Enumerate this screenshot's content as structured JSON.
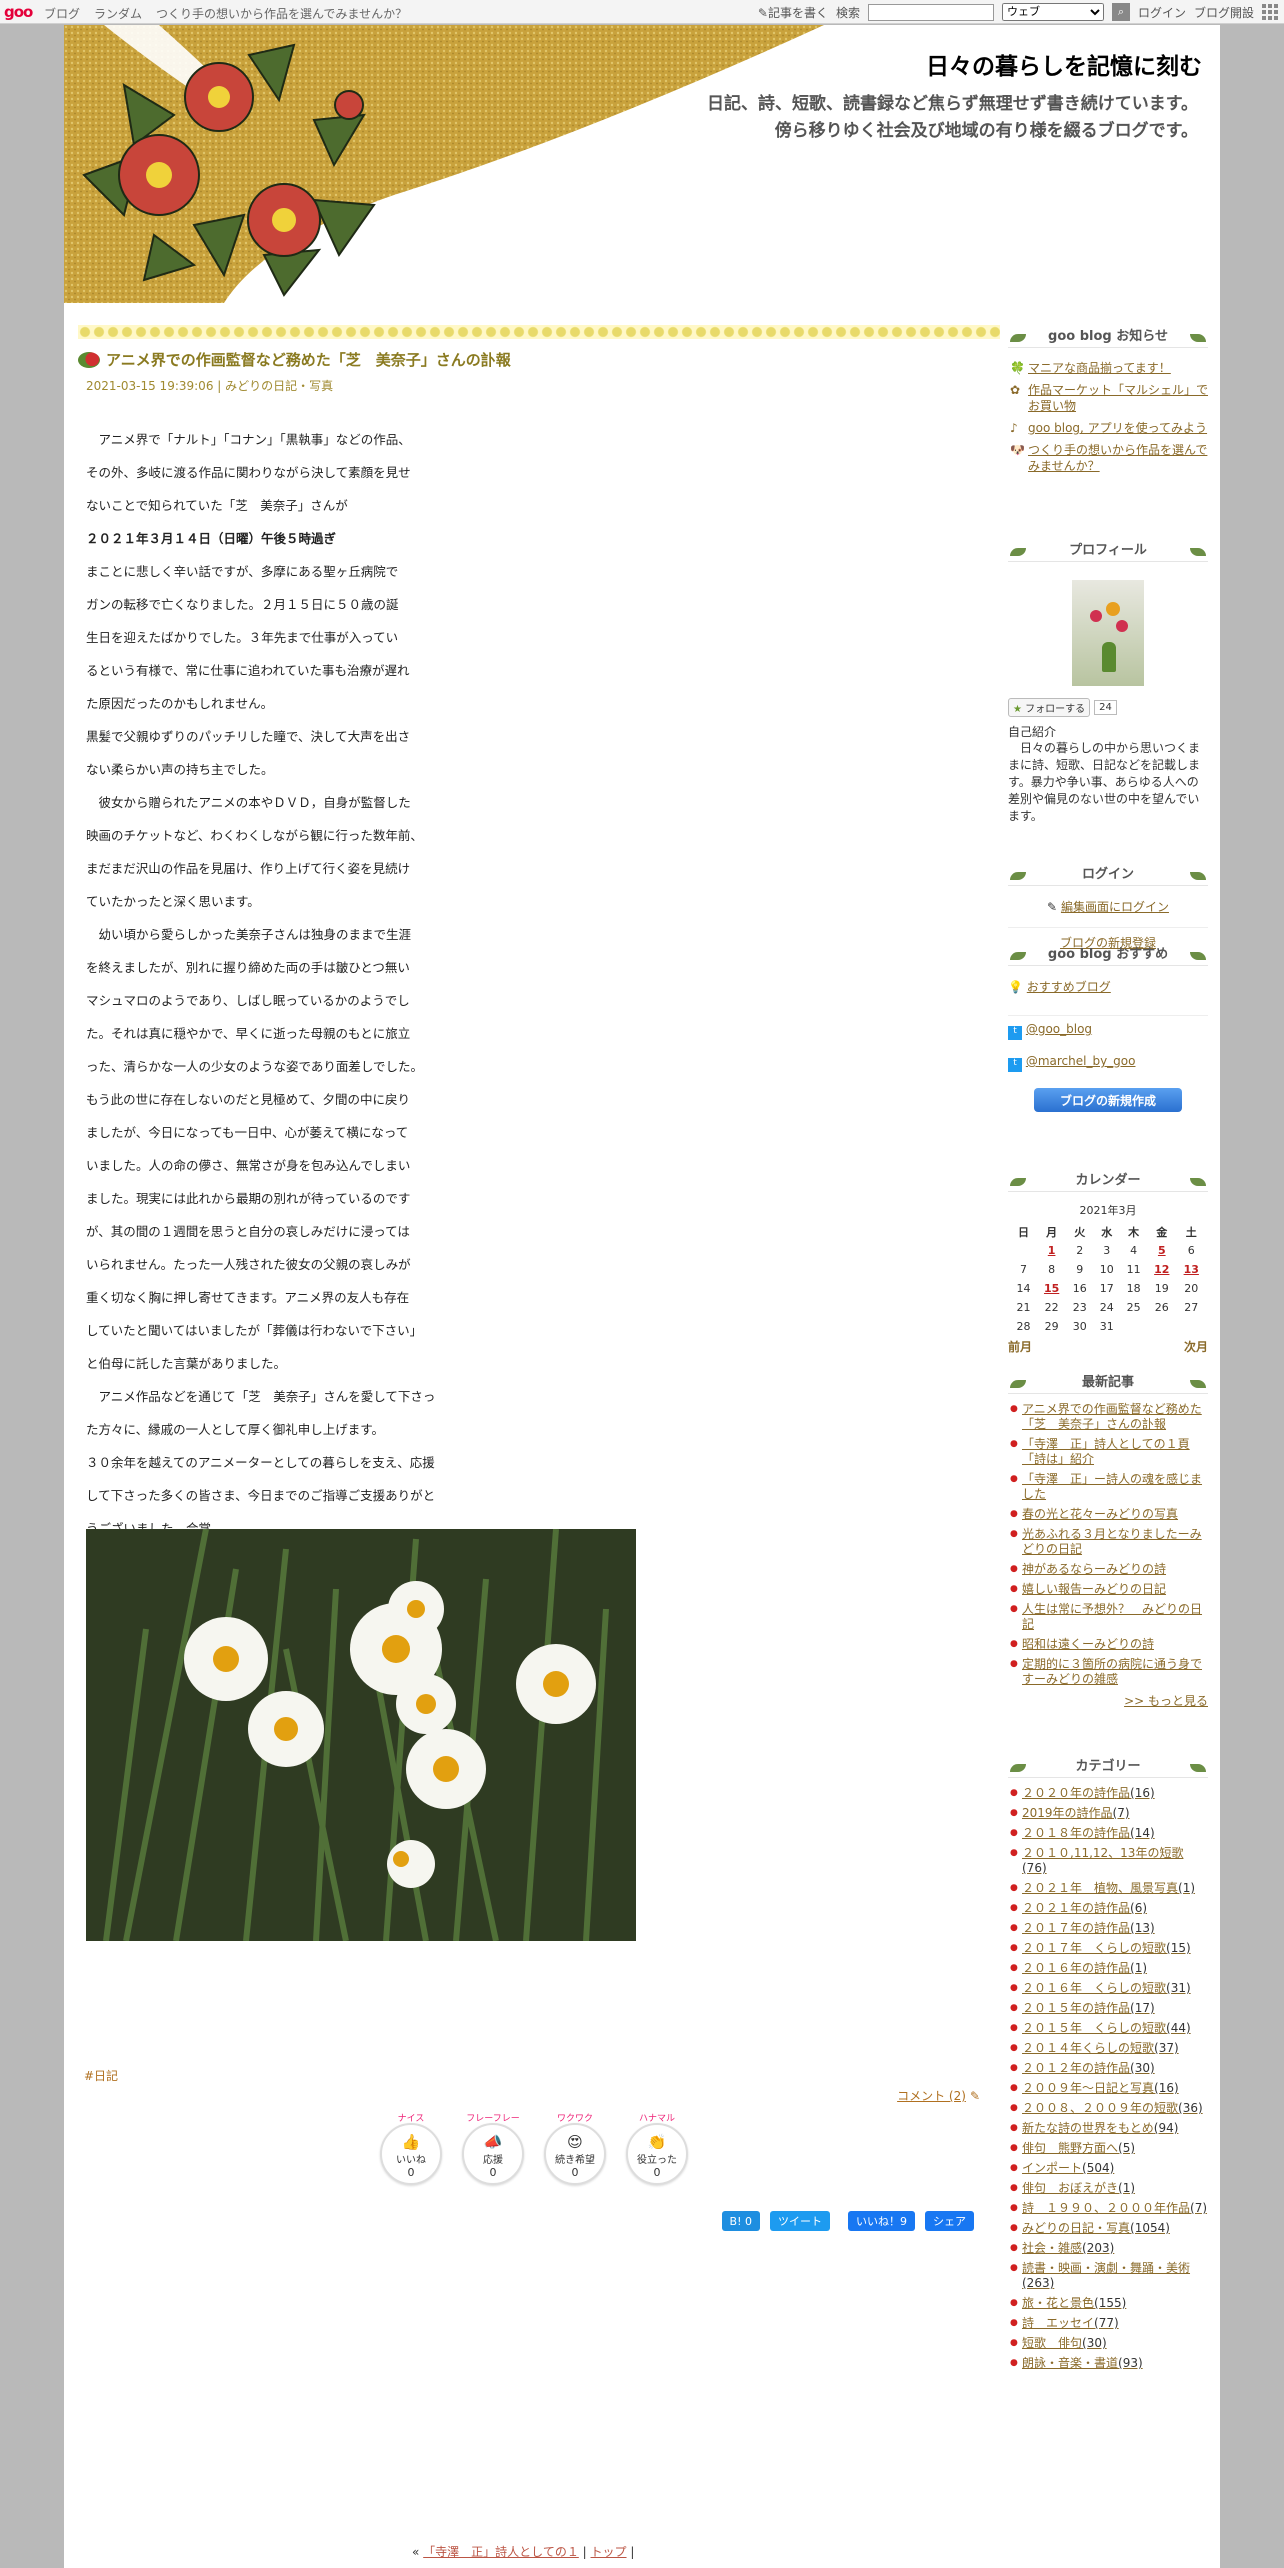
{
  "topbar": {
    "logo": "goo",
    "nav": [
      "ブログ",
      "ランダム",
      "つくり手の想いから作品を選んでみませんか？"
    ],
    "write": "記事を書く",
    "search_label": "検索",
    "search_select": "ウェブ",
    "login": "ログイン",
    "open_blog": "ブログ開設"
  },
  "header": {
    "title": "日々の暮らしを記憶に刻む",
    "desc_line1": "日記、詩、短歌、読書録など焦らず無理せず書き続けています。",
    "desc_line2": "傍ら移りゆく社会及び地域の有り様を綴るブログです。"
  },
  "entry": {
    "title": "アニメ界での作画監督など務めた「芝　美奈子」さんの訃報",
    "date": "2021-03-15 19:39:06",
    "category": "みどりの日記・写真",
    "body": [
      "　アニメ界で「ナルト」「コナン」「黒執事」などの作品、",
      "その外、多岐に渡る作品に関わりながら決して素顔を見せ",
      "ないことで知られていた「芝　美奈子」さんが",
      "２０２１年３月１４日（日曜）午後５時過ぎ",
      "まことに悲しく辛い話ですが、多摩にある聖ヶ丘病院で",
      "ガンの転移で亡くなりました。２月１５日に５０歳の誕",
      "生日を迎えたばかりでした。３年先まで仕事が入ってい",
      "るという有様で、常に仕事に追われていた事も治療が遅れ",
      "た原因だったのかもしれません。",
      "黒髪で父親ゆずりのパッチリした瞳で、決して大声を出さ",
      "ない柔らかい声の持ち主でした。",
      "　彼女から贈られたアニメの本やＤＶＤ，自身が監督した",
      "映画のチケットなど、わくわくしながら観に行った数年前、",
      "まだまだ沢山の作品を見届け、作り上げて行く姿を見続け",
      "ていたかったと深く思います。",
      "　幼い頃から愛らしかった美奈子さんは独身のままで生涯",
      "を終えましたが、別れに握り締めた両の手は皺ひとつ無い",
      "マシュマロのようであり、しばし眠っているかのようでし",
      "た。それは真に穏やかで、早くに逝った母親のもとに旅立",
      "った、清らかな一人の少女のような姿であり面差しでした。",
      "もう此の世に存在しないのだと見極めて、夕間の中に戻り",
      "ましたが、今日になっても一日中、心が萎えて横になって",
      "いました。人の命の儚さ、無常さが身を包み込んでしまい",
      "ました。現実には此れから最期の別れが待っているのです",
      "が、其の間の１週間を思うと自分の哀しみだけに浸っては",
      "いられません。たった一人残された彼女の父親の哀しみが",
      "重く切なく胸に押し寄せてきます。アニメ界の友人も存在",
      "していたと聞いてはいましたが「葬儀は行わないで下さい」",
      "と伯母に託した言葉がありました。",
      "　アニメ作品などを通じて「芝　美奈子」さんを愛して下さっ",
      "た方々に、縁戚の一人として厚く御礼申し上げます。",
      "３０余年を越えてのアニメーターとしての暮らしを支え、応援",
      "して下さった多くの皆さま、今日までのご指導ご支援ありがと",
      "うございました。合掌"
    ],
    "bold_index": 3,
    "tag": "#日記",
    "comment": "コメント (2)",
    "reactions": [
      {
        "top": "ナイス",
        "emoji": "👍",
        "label": "いいね",
        "count": "0"
      },
      {
        "top": "フレーフレー",
        "emoji": "📣",
        "label": "応援",
        "count": "0"
      },
      {
        "top": "ワクワク",
        "emoji": "😍",
        "label": "続き希望",
        "count": "0"
      },
      {
        "top": "ハナマル",
        "emoji": "👏",
        "label": "役立った",
        "count": "0"
      }
    ],
    "share": {
      "hatena": "B! 0",
      "tweet": "ツイート",
      "fb_like": "いいね！9",
      "share": "シェア"
    },
    "pager": {
      "prev_mark": "«",
      "prev": "「寺澤　正」詩人としての１",
      "top": "トップ"
    }
  },
  "sidebar": {
    "notice_title": "goo blog お知らせ",
    "notices": [
      {
        "icon": "🍀",
        "text": "マニアな商品揃ってます！"
      },
      {
        "icon": "✿",
        "text": "作品マーケット「マルシェル」でお買い物"
      },
      {
        "icon": "♪",
        "text": "goo blog, アプリを使ってみよう"
      },
      {
        "icon": "🐶",
        "text": "つくり手の想いから作品を選んでみませんか？"
      }
    ],
    "profile_title": "プロフィール",
    "follow": "フォローする",
    "follow_count": "24",
    "intro_label": "自己紹介",
    "intro": "　日々の暮らしの中から思いつくままに詩、短歌、日記などを記載します。暴力や争い事、あらゆる人への差別や偏見のない世の中を望んでいます。",
    "login_title": "ログイン",
    "login_edit": "編集画面にログイン",
    "new_blog": "ブログの新規登録",
    "recommend_title": "goo blog おすすめ",
    "recommend": "おすすめブログ",
    "twitter1": "@goo_blog",
    "twitter2": "@marchel_by_goo",
    "create_button": "ブログの新規作成",
    "calendar_title": "カレンダー",
    "calendar": {
      "month": "2021年3月",
      "weekdays": [
        "日",
        "月",
        "火",
        "水",
        "木",
        "金",
        "土"
      ],
      "weeks": [
        [
          "",
          "1",
          "2",
          "3",
          "4",
          "5",
          "6"
        ],
        [
          "7",
          "8",
          "9",
          "10",
          "11",
          "12",
          "13"
        ],
        [
          "14",
          "15",
          "16",
          "17",
          "18",
          "19",
          "20"
        ],
        [
          "21",
          "22",
          "23",
          "24",
          "25",
          "26",
          "27"
        ],
        [
          "28",
          "29",
          "30",
          "31",
          "",
          "",
          ""
        ]
      ],
      "linked": [
        "1",
        "5",
        "12",
        "13",
        "15"
      ],
      "prev": "前月",
      "next": "次月"
    },
    "recent_title": "最新記事",
    "recent": [
      "アニメ界での作画監督など務めた「芝　美奈子」さんの訃報",
      "「寺澤　正」詩人としての１頁「詩は」紹介",
      "「寺澤　正」ー詩人の魂を感じました",
      "春の光と花々ーみどりの写真",
      "光あふれる３月となりましたーみどりの日記",
      "神があるならーみどりの詩",
      "嬉しい報告ーみどりの日記",
      "人生は常に予想外？　みどりの日記",
      "昭和は遠くーみどりの詩",
      "定期的に３箇所の病院に通う身ですーみどりの雑感"
    ],
    "more": ">> もっと見る",
    "category_title": "カテゴリー",
    "categories": [
      {
        "name": "２０２０年の詩作品",
        "count": "(16)"
      },
      {
        "name": "2019年の詩作品",
        "count": "(7)"
      },
      {
        "name": "２０１８年の詩作品",
        "count": "(14)"
      },
      {
        "name": "２０１０,11,12、13年の短歌",
        "count": "(76)"
      },
      {
        "name": "２０２１年　植物、風景写真",
        "count": "(1)"
      },
      {
        "name": "２０２１年の詩作品",
        "count": "(6)"
      },
      {
        "name": "２０１７年の詩作品",
        "count": "(13)"
      },
      {
        "name": "２０１７年　くらしの短歌",
        "count": "(15)"
      },
      {
        "name": "２０１６年の詩作品",
        "count": "(1)"
      },
      {
        "name": "２０１６年　くらしの短歌",
        "count": "(31)"
      },
      {
        "name": "２０１５年の詩作品",
        "count": "(17)"
      },
      {
        "name": "２０１５年　くらしの短歌",
        "count": "(44)"
      },
      {
        "name": "２０１４年くらしの短歌",
        "count": "(37)"
      },
      {
        "name": "２０１２年の詩作品",
        "count": "(30)"
      },
      {
        "name": "２００９年～日記と写真",
        "count": "(16)"
      },
      {
        "name": "２００８、２００９年の短歌",
        "count": "(36)"
      },
      {
        "name": "新たな詩の世界をもとめ",
        "count": "(94)"
      },
      {
        "name": "俳句　熊野方面へ",
        "count": "(5)"
      },
      {
        "name": "インポート",
        "count": "(504)"
      },
      {
        "name": "俳句　おぼえがき",
        "count": "(1)"
      },
      {
        "name": "詩　１９９０、２０００年作品",
        "count": "(7)"
      },
      {
        "name": "みどりの日記・写真",
        "count": "(1054)"
      },
      {
        "name": "社会・雑感",
        "count": "(203)"
      },
      {
        "name": "読書・映画・演劇・舞踊・美術",
        "count": "(263)"
      },
      {
        "name": "旅・花と景色",
        "count": "(155)"
      },
      {
        "name": "詩　エッセイ",
        "count": "(77)"
      },
      {
        "name": "短歌　俳句",
        "count": "(30)"
      },
      {
        "name": "朗詠・音楽・書道",
        "count": "(93)"
      }
    ]
  }
}
